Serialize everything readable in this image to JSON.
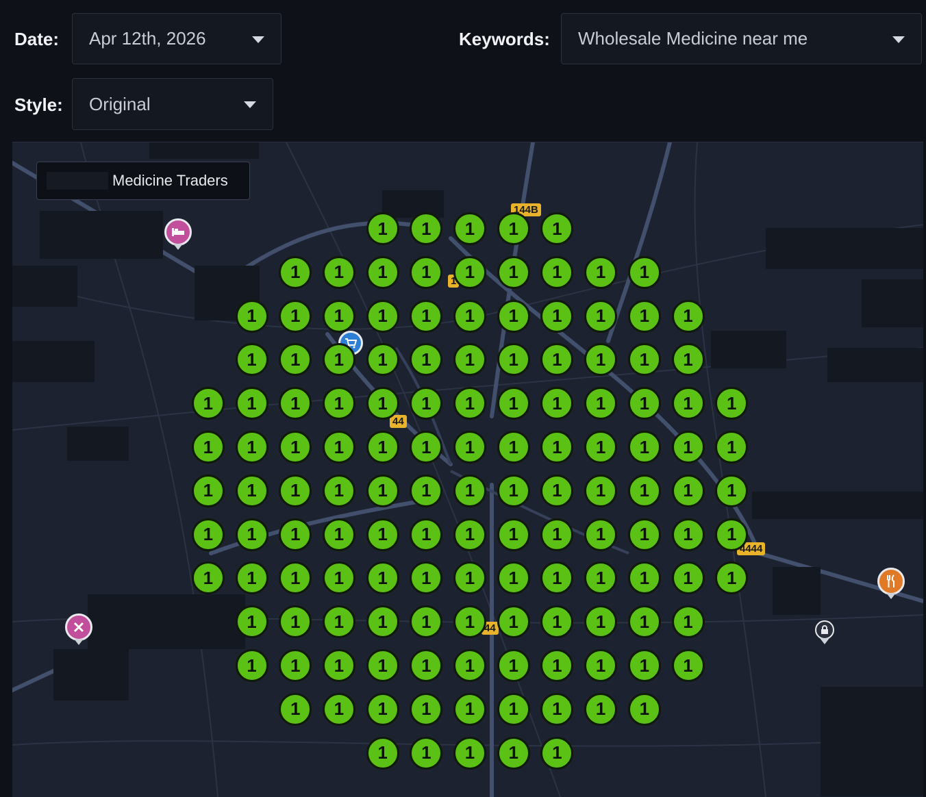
{
  "filters": {
    "date_label": "Date:",
    "date_value": "Apr 12th, 2026",
    "keywords_label": "Keywords:",
    "keywords_value": "Wholesale Medicine near me",
    "style_label": "Style:",
    "style_value": "Original"
  },
  "map": {
    "business_tooltip": "Medicine Traders",
    "road_labels": [
      "144B",
      "44",
      "4444",
      "44",
      "1"
    ],
    "pins": [
      {
        "icon": "hotel-icon",
        "color": "#c24f9b"
      },
      {
        "icon": "tools-icon",
        "color": "#c24f9b"
      },
      {
        "icon": "restaurant-icon",
        "color": "#e07a27"
      },
      {
        "icon": "shopping-cart-icon",
        "color": "#2d7fd6"
      },
      {
        "icon": "lock-icon",
        "color": "#2a2f3b"
      }
    ],
    "rank_grid": {
      "rank_color": "#5cc115",
      "rows": [
        [
          1,
          1,
          1,
          1,
          1
        ],
        [
          1,
          1,
          1,
          1,
          1,
          1,
          1,
          1,
          1
        ],
        [
          1,
          1,
          1,
          1,
          1,
          1,
          1,
          1,
          1,
          1,
          1
        ],
        [
          1,
          1,
          1,
          1,
          1,
          1,
          1,
          1,
          1,
          1,
          1
        ],
        [
          1,
          1,
          1,
          1,
          1,
          1,
          1,
          1,
          1,
          1,
          1,
          1,
          1
        ],
        [
          1,
          1,
          1,
          1,
          1,
          1,
          1,
          1,
          1,
          1,
          1,
          1,
          1
        ],
        [
          1,
          1,
          1,
          1,
          1,
          1,
          1,
          1,
          1,
          1,
          1,
          1,
          1
        ],
        [
          1,
          1,
          1,
          1,
          1,
          1,
          1,
          1,
          1,
          1,
          1,
          1,
          1
        ],
        [
          1,
          1,
          1,
          1,
          1,
          1,
          1,
          1,
          1,
          1,
          1,
          1,
          1
        ],
        [
          1,
          1,
          1,
          1,
          1,
          1,
          1,
          1,
          1,
          1,
          1
        ],
        [
          1,
          1,
          1,
          1,
          1,
          1,
          1,
          1,
          1,
          1,
          1
        ],
        [
          1,
          1,
          1,
          1,
          1,
          1,
          1,
          1,
          1
        ],
        [
          1,
          1,
          1,
          1,
          1
        ]
      ]
    }
  }
}
